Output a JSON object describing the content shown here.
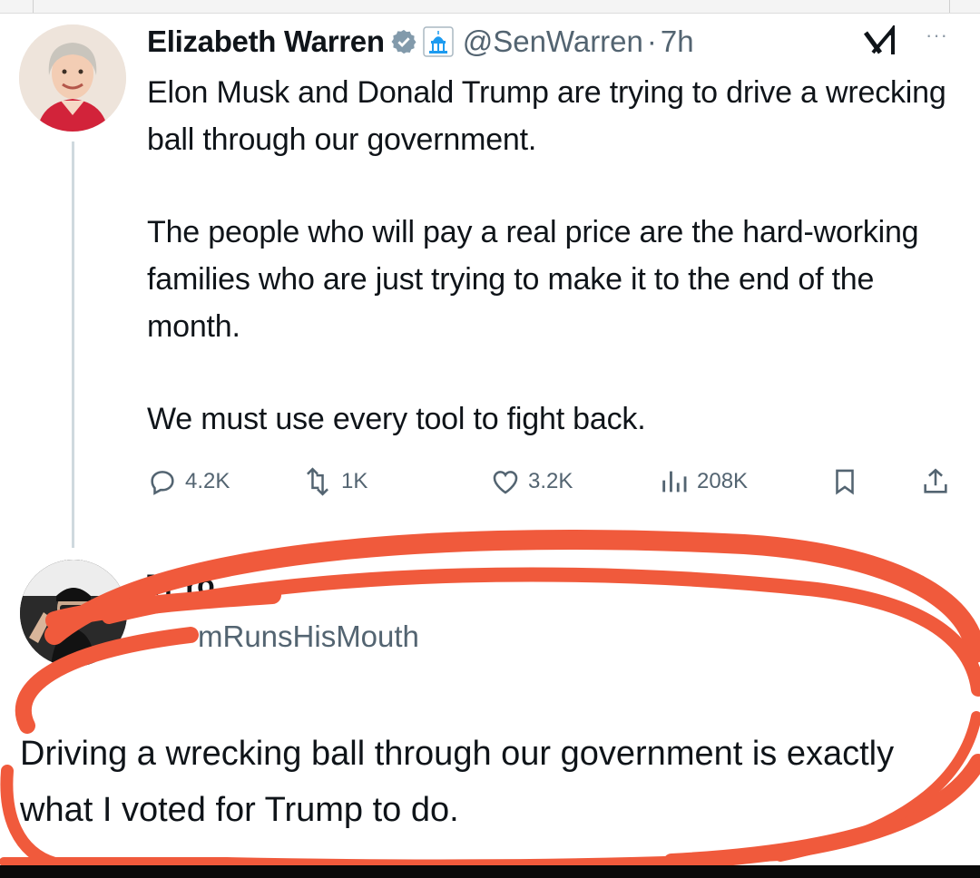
{
  "tweet": {
    "author_name": "Elizabeth Warren",
    "handle": "@SenWarren",
    "separator": "·",
    "time": "7h",
    "more": "···",
    "paragraphs": [
      "Elon Musk and Donald Trump are trying to drive a wrecking ball through our government.",
      "The people who will pay a real price are the hard-working families who are just trying to make it to the end of the month.",
      "We must use every tool to fight back."
    ],
    "stats": {
      "replies": "4.2K",
      "reposts": "1K",
      "likes": "3.2K",
      "views": "208K"
    }
  },
  "reply": {
    "name_fragment": "Ti    Yo",
    "handle_fragment": "mRunsHisMouth",
    "text": "Driving a wrecking ball through our government is exactly what I voted for Trump to do."
  },
  "icons": {
    "verified": "verified-badge-icon",
    "affiliation": "capitol-icon",
    "grok": "grok-icon",
    "more": "more-icon",
    "reply": "reply-icon",
    "repost": "repost-icon",
    "like": "heart-icon",
    "views": "views-icon",
    "bookmark": "bookmark-icon",
    "share": "share-icon"
  },
  "colors": {
    "text": "#0f1419",
    "muted": "#536471",
    "verified": "#829aab",
    "annotation_red": "#f05a3c"
  }
}
